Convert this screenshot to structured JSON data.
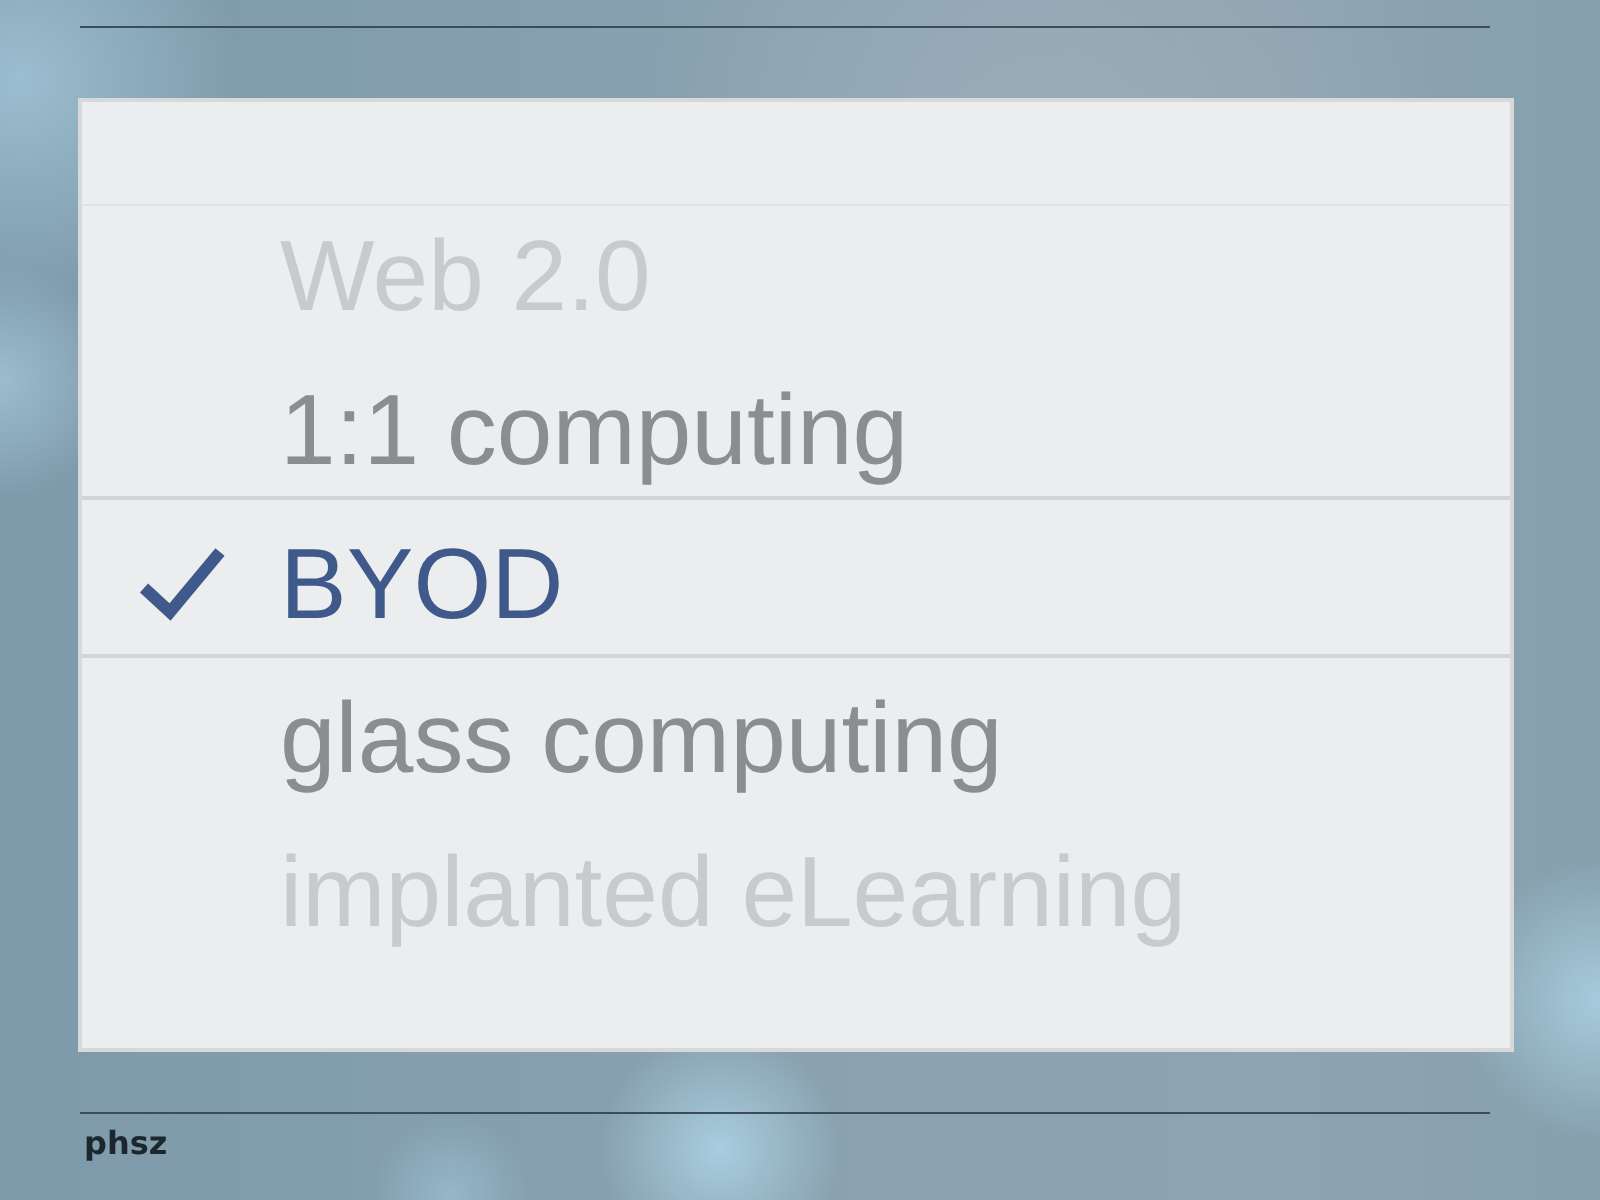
{
  "picker": {
    "items": [
      {
        "label": "Web 2.0",
        "selected": false,
        "dimmed": true
      },
      {
        "label": "1:1 computing",
        "selected": false,
        "dimmed": false
      },
      {
        "label": "BYOD",
        "selected": true,
        "dimmed": false
      },
      {
        "label": "glass computing",
        "selected": false,
        "dimmed": false
      },
      {
        "label": "implanted eLearning",
        "selected": false,
        "dimmed": true
      }
    ]
  },
  "footer": {
    "label": "phsz"
  }
}
